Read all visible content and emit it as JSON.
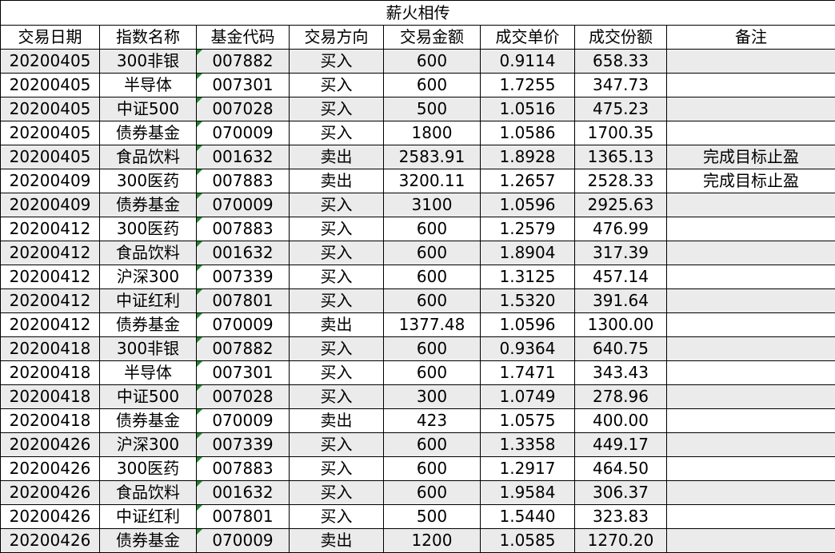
{
  "title": "薪火相传",
  "headers": [
    "交易日期",
    "指数名称",
    "基金代码",
    "交易方向",
    "交易金额",
    "成交单价",
    "成交份额",
    "备注"
  ],
  "rows": [
    [
      "20200405",
      "300非银",
      "007882",
      "买入",
      "600",
      "0.9114",
      "658.33",
      ""
    ],
    [
      "20200405",
      "半导体",
      "007301",
      "买入",
      "600",
      "1.7255",
      "347.73",
      ""
    ],
    [
      "20200405",
      "中证500",
      "007028",
      "买入",
      "500",
      "1.0516",
      "475.23",
      ""
    ],
    [
      "20200405",
      "债券基金",
      "070009",
      "买入",
      "1800",
      "1.0586",
      "1700.35",
      ""
    ],
    [
      "20200405",
      "食品饮料",
      "001632",
      "卖出",
      "2583.91",
      "1.8928",
      "1365.13",
      "完成目标止盈"
    ],
    [
      "20200409",
      "300医药",
      "007883",
      "卖出",
      "3200.11",
      "1.2657",
      "2528.33",
      "完成目标止盈"
    ],
    [
      "20200409",
      "债券基金",
      "070009",
      "买入",
      "3100",
      "1.0596",
      "2925.63",
      ""
    ],
    [
      "20200412",
      "300医药",
      "007883",
      "买入",
      "600",
      "1.2579",
      "476.99",
      ""
    ],
    [
      "20200412",
      "食品饮料",
      "001632",
      "买入",
      "600",
      "1.8904",
      "317.39",
      ""
    ],
    [
      "20200412",
      "沪深300",
      "007339",
      "买入",
      "600",
      "1.3125",
      "457.14",
      ""
    ],
    [
      "20200412",
      "中证红利",
      "007801",
      "买入",
      "600",
      "1.5320",
      "391.64",
      ""
    ],
    [
      "20200412",
      "债券基金",
      "070009",
      "卖出",
      "1377.48",
      "1.0596",
      "1300.00",
      ""
    ],
    [
      "20200418",
      "300非银",
      "007882",
      "买入",
      "600",
      "0.9364",
      "640.75",
      ""
    ],
    [
      "20200418",
      "半导体",
      "007301",
      "买入",
      "600",
      "1.7471",
      "343.43",
      ""
    ],
    [
      "20200418",
      "中证500",
      "007028",
      "买入",
      "300",
      "1.0749",
      "278.96",
      ""
    ],
    [
      "20200418",
      "债券基金",
      "070009",
      "卖出",
      "423",
      "1.0575",
      "400.00",
      ""
    ],
    [
      "20200426",
      "沪深300",
      "007339",
      "买入",
      "600",
      "1.3358",
      "449.17",
      ""
    ],
    [
      "20200426",
      "300医药",
      "007883",
      "买入",
      "600",
      "1.2917",
      "464.50",
      ""
    ],
    [
      "20200426",
      "食品饮料",
      "001632",
      "买入",
      "600",
      "1.9584",
      "306.37",
      ""
    ],
    [
      "20200426",
      "中证红利",
      "007801",
      "买入",
      "500",
      "1.5440",
      "323.83",
      ""
    ],
    [
      "20200426",
      "债券基金",
      "070009",
      "卖出",
      "1200",
      "1.0585",
      "1270.20",
      ""
    ]
  ]
}
